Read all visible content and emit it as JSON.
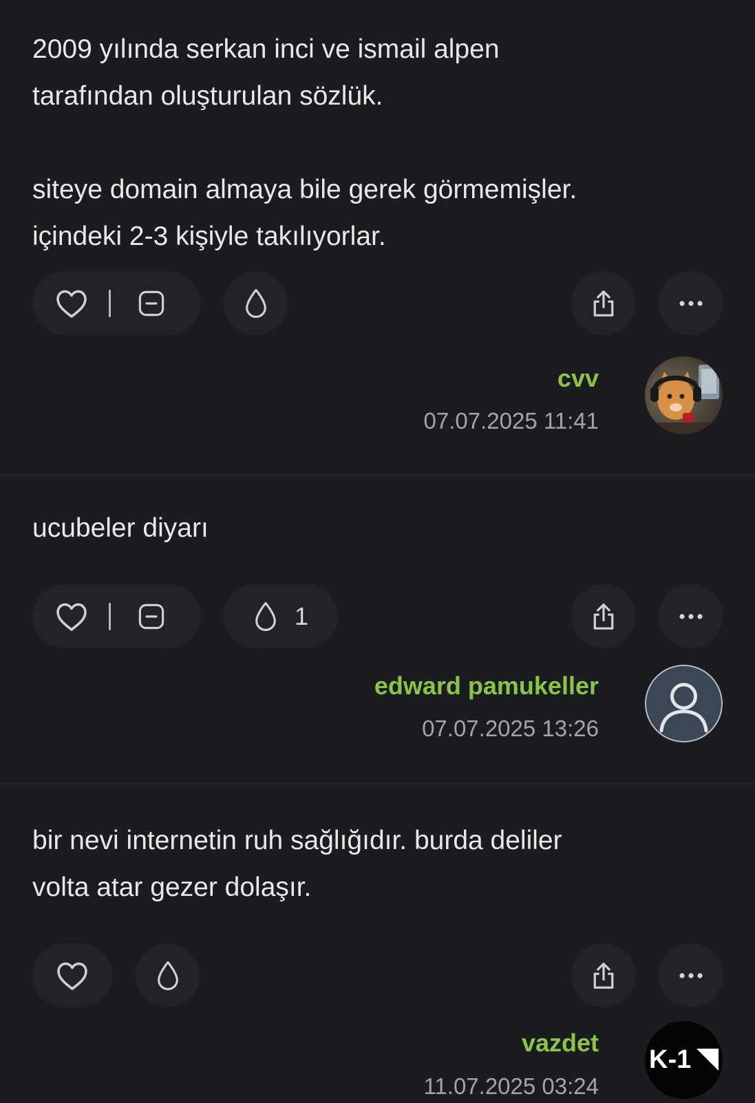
{
  "entries": [
    {
      "text": "2009 yılında serkan inci ve ismail alpen\ntarafından oluşturulan sözlük.\n\nsiteye domain almaya bile gerek görmemişler.\niçindeki 2-3 kişiyle takılıyorlar.",
      "author": "cvv",
      "date": "07.07.2025 11:41",
      "drop_count": ""
    },
    {
      "text": "ucubeler diyarı",
      "author": "edward pamukeller",
      "date": "07.07.2025 13:26",
      "drop_count": "1"
    },
    {
      "text": "bir nevi internetin ruh sağlığıdır. burda deliler\nvolta atar gezer dolaşır.",
      "author": "vazdet",
      "date": "11.07.2025 03:24",
      "drop_count": ""
    }
  ],
  "avatar_logo_text": "K-1",
  "icons": [
    "heart-icon",
    "minus-square-icon",
    "drop-icon",
    "share-icon",
    "more-icon",
    "user-icon"
  ],
  "colors": {
    "background": "#1b1c20",
    "pill": "#222327",
    "author": "#8cc34f",
    "date": "#a4a5a9",
    "text": "#e9e9ea"
  }
}
